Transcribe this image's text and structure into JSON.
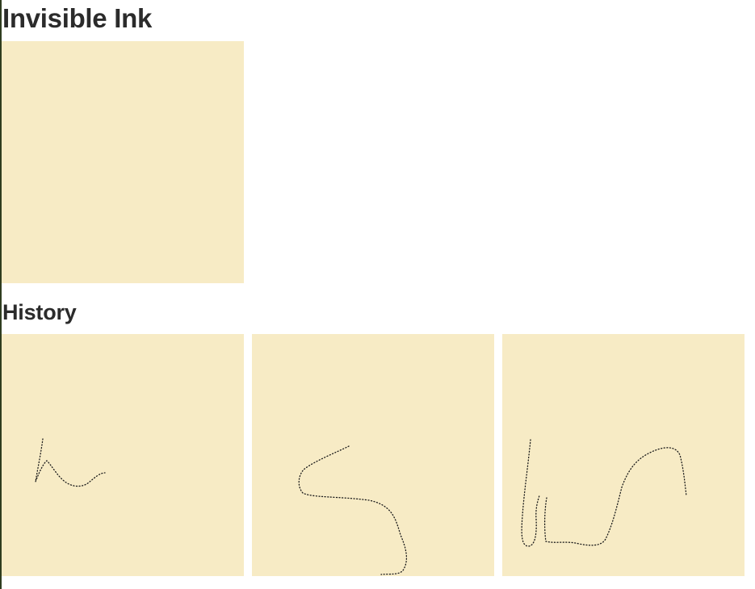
{
  "app": {
    "title": "Invisible Ink"
  },
  "history": {
    "heading": "History",
    "items": [
      {
        "name": "history-drawing-1"
      },
      {
        "name": "history-drawing-2"
      },
      {
        "name": "history-drawing-3"
      }
    ]
  },
  "colors": {
    "canvas": "#f7ebc5",
    "ink": "#1a1a1a",
    "text": "#2b2b2b"
  }
}
